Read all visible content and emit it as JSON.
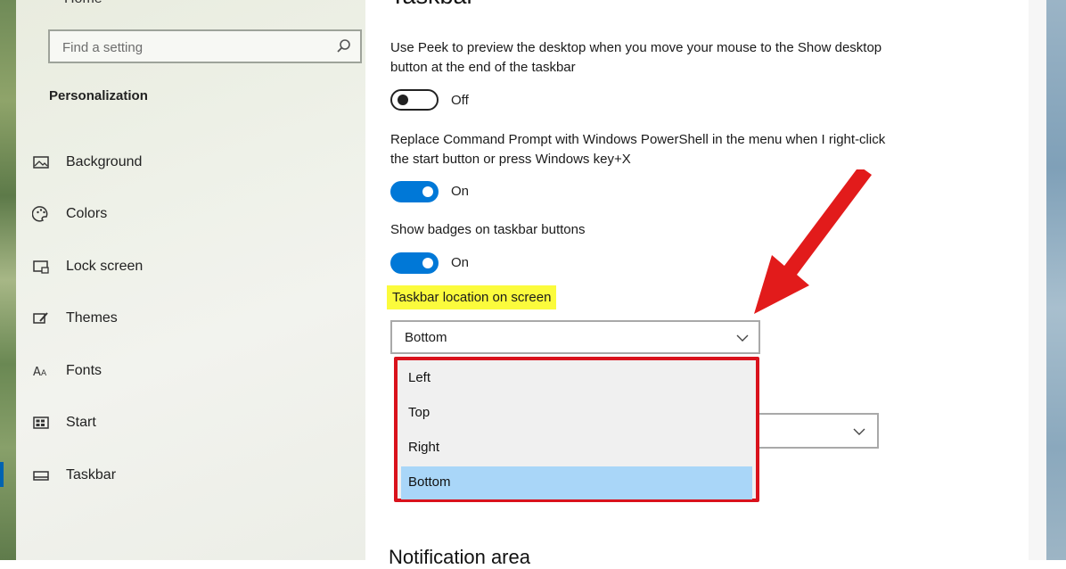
{
  "sidebar": {
    "home_label": "Home",
    "search_placeholder": "Find a setting",
    "section_title": "Personalization",
    "items": [
      {
        "label": "Background",
        "icon": "image-icon"
      },
      {
        "label": "Colors",
        "icon": "palette-icon"
      },
      {
        "label": "Lock screen",
        "icon": "lock-screen-icon"
      },
      {
        "label": "Themes",
        "icon": "themes-brush-icon"
      },
      {
        "label": "Fonts",
        "icon": "fonts-icon"
      },
      {
        "label": "Start",
        "icon": "start-grid-icon"
      },
      {
        "label": "Taskbar",
        "icon": "taskbar-icon"
      }
    ],
    "selected": "Taskbar"
  },
  "main": {
    "title": "Taskbar",
    "settings": [
      {
        "description": "Use Peek to preview the desktop when you move your mouse to the Show desktop button at the end of the taskbar",
        "state": "Off"
      },
      {
        "description": "Replace Command Prompt with Windows PowerShell in the menu when I right-click the start button or press Windows key+X",
        "state": "On"
      },
      {
        "description": "Show badges on taskbar buttons",
        "state": "On"
      }
    ],
    "taskbar_location": {
      "label": "Taskbar location on screen",
      "selected": "Bottom",
      "options": [
        "Left",
        "Top",
        "Right",
        "Bottom"
      ]
    },
    "next_section_title": "Notification area"
  },
  "colors": {
    "accent": "#0078d7",
    "highlight_yellow": "#fbfb3c",
    "annotation_red": "#d9121c",
    "selected_option": "#a9d6f8"
  }
}
